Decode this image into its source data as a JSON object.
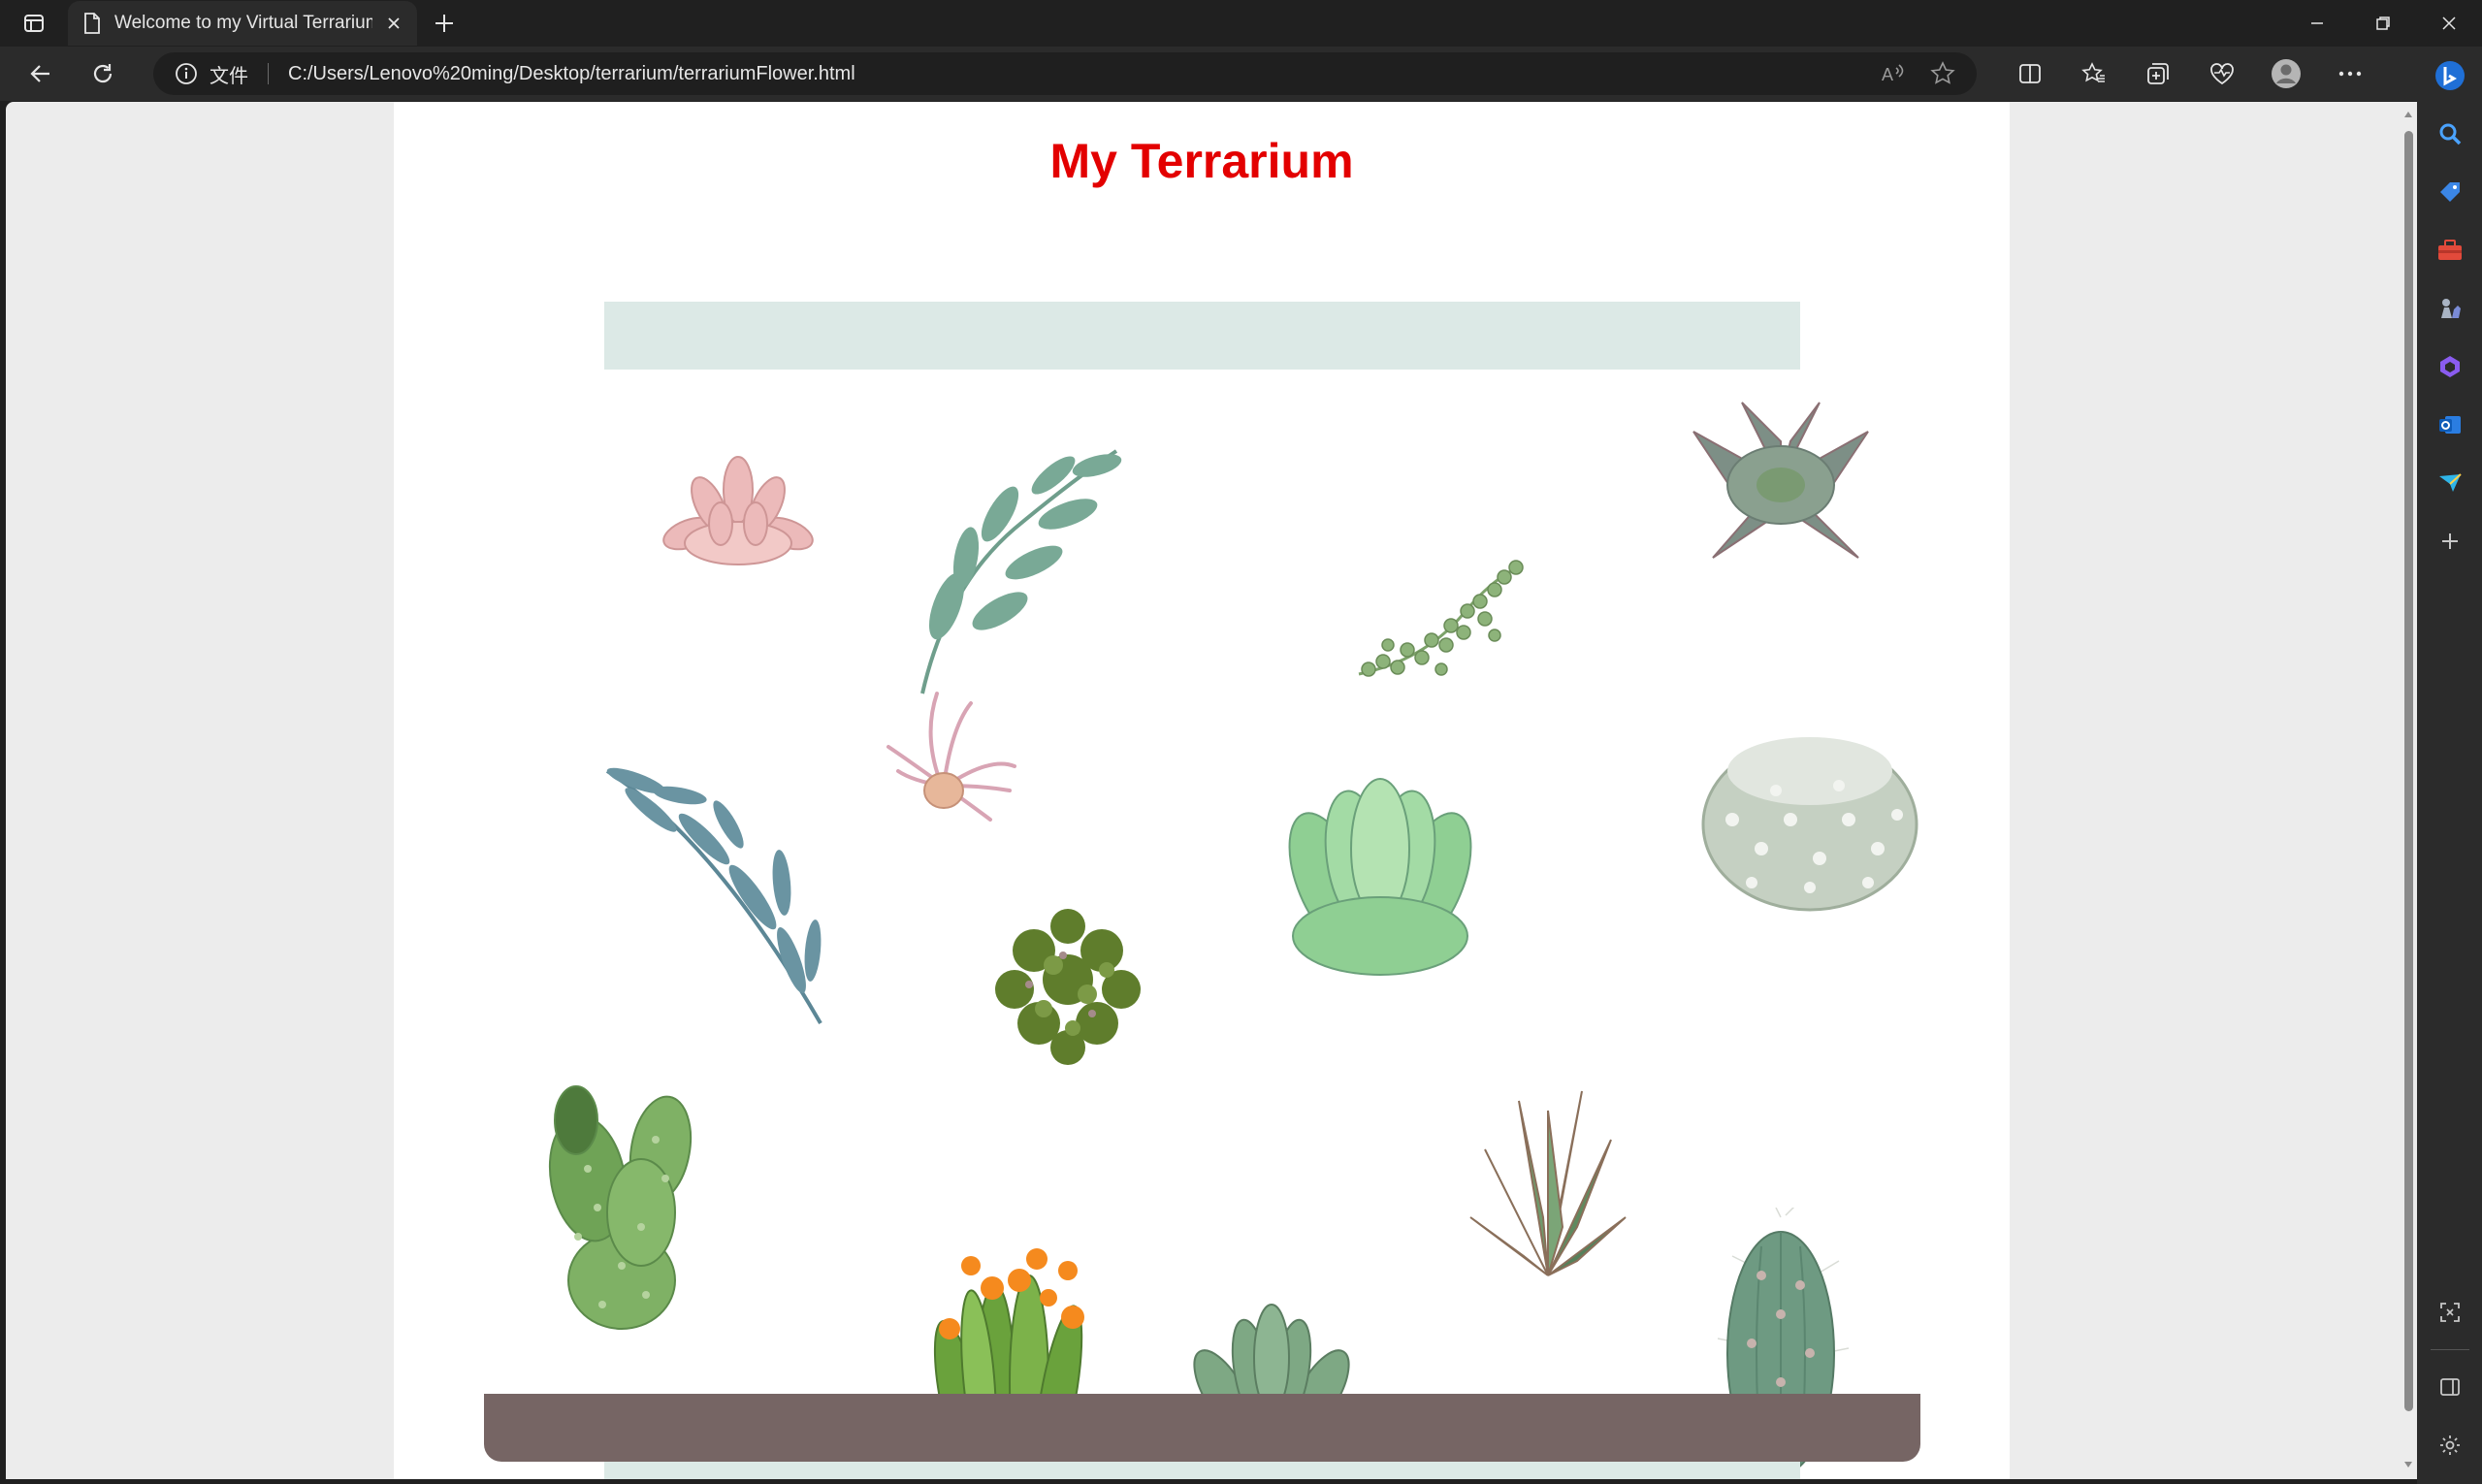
{
  "browser": {
    "tab_title": "Welcome to my Virtual Terrarium",
    "site_info_label": "文件",
    "url": "C:/Users/Lenovo%20ming/Desktop/terrarium/terrariumFlower.html"
  },
  "page": {
    "title": "My Terrarium"
  },
  "colors": {
    "title": "#e30000",
    "jar_glass": "#dce9e6",
    "jar_base": "#766564",
    "browser_chrome": "#202020"
  },
  "icons": {
    "tab_actions": "tab-actions-icon",
    "page": "page-icon",
    "close_tab": "close-icon",
    "new_tab": "plus-icon",
    "back": "back-arrow-icon",
    "refresh": "refresh-icon",
    "info": "info-icon",
    "read_aloud": "read-aloud-icon",
    "favorite": "star-icon",
    "split": "split-screen-icon",
    "favorites": "favorites-icon",
    "collections": "collections-icon",
    "health": "browser-essentials-icon",
    "profile": "profile-icon",
    "more": "more-icon",
    "copilot": "copilot-icon"
  },
  "plants": [
    "pink-succulent",
    "eucalyptus-sprig",
    "string-of-pearls",
    "echeveria-gray",
    "blue-fern-sprig",
    "air-plant",
    "green-echeveria",
    "round-cactus",
    "leafy-shrub",
    "prickly-pear-cactus",
    "aloe-succulent",
    "flowering-cactus",
    "rosette-succulent",
    "column-cactus"
  ]
}
